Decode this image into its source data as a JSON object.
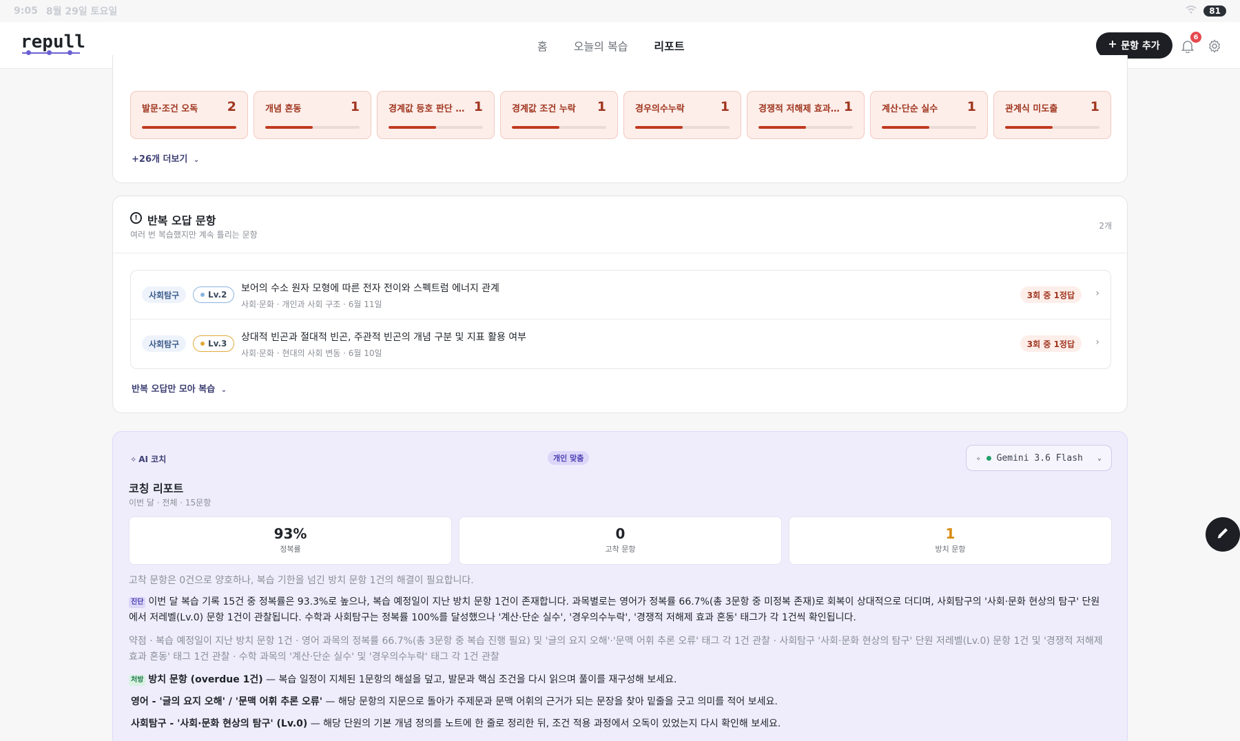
{
  "status_bar": {
    "time": "9:05",
    "date": "8월 29일 토요일",
    "battery": "81"
  },
  "header": {
    "logo": "repull",
    "nav": [
      {
        "label": "홈"
      },
      {
        "label": "오늘의 복습"
      },
      {
        "label": "리포트",
        "active": true
      }
    ],
    "add_button": "문항 추가",
    "notification_count": "6"
  },
  "error_tags": {
    "items": [
      {
        "name": "발문·조건 오독",
        "count": "2",
        "fill": 1.0
      },
      {
        "name": "개념 혼동",
        "count": "1",
        "fill": 0.5
      },
      {
        "name": "경계값 등호 판단 실수",
        "count": "1",
        "fill": 0.5
      },
      {
        "name": "경계값 조건 누락",
        "count": "1",
        "fill": 0.5
      },
      {
        "name": "경우의수누락",
        "count": "1",
        "fill": 0.5
      },
      {
        "name": "경쟁적 저해제 효과 혼동",
        "count": "1",
        "fill": 0.5
      },
      {
        "name": "계산·단순 실수",
        "count": "1",
        "fill": 0.5
      },
      {
        "name": "관계식 미도출",
        "count": "1",
        "fill": 0.5
      }
    ],
    "more_label": "+26개 더보기"
  },
  "repeat_errors": {
    "title": "반복 오답 문항",
    "subtitle": "여러 번 복습했지만 계속 틀리는 문항",
    "count": "2개",
    "items": [
      {
        "subject": "사회탐구",
        "level": "Lv.2",
        "level_color": "#8ab4e0",
        "title": "보어의 수소 원자 모형에 따른 전자 전이와 스펙트럼 에너지 관계",
        "meta": "사회·문화 · 개인과 사회 구조 · 6월 11일",
        "stage": "3회 중 1정답"
      },
      {
        "subject": "사회탐구",
        "level": "Lv.3",
        "level_color": "#e0a93a",
        "title": "상대적 빈곤과 절대적 빈곤, 주관적 빈곤의 개념 구분 및 지표 활용 여부",
        "meta": "사회·문화 · 현대의 사회 변동 · 6월 10일",
        "stage": "3회 중 1정답"
      }
    ],
    "review_label": "반복 오답만 모아 복습"
  },
  "coach": {
    "label": "AI 코치",
    "personalized": "개인 맞춤",
    "model": "Gemini 3.6 Flash",
    "title": "코칭 리포트",
    "subtitle": "이번 달 · 전체 · 15문항",
    "stats": [
      {
        "value": "93%",
        "label": "정복률",
        "color": "#1f2328"
      },
      {
        "value": "0",
        "label": "고착 문항",
        "color": "#1f2328"
      },
      {
        "value": "1",
        "label": "방치 문항",
        "color": "#d98a12"
      }
    ],
    "summary": "고착 문항은 0건으로 양호하나, 복습 기한을 넘긴 방치 문항 1건의 해결이 필요합니다.",
    "diagnosis_tag": "진단",
    "diagnosis": "이번 달 복습 기록 15건 중 정복률은 93.3%로 높으나, 복습 예정일이 지난 방치 문항 1건이 존재합니다. 과목별로는 영어가 정복률 66.7%(총 3문항 중 미정복 존재)로 회복이 상대적으로 더디며, 사회탐구의 '사회·문화 현상의 탐구' 단원에서 저레벨(Lv.0) 문항 1건이 관찰됩니다. 수학과 사회탐구는 정복률 100%를 달성했으나 '계산·단순 실수', '경우의수누락', '경쟁적 저해제 효과 혼동' 태그가 각 1건씩 확인됩니다.",
    "weakness": "약점 · 복습 예정일이 지난 방치 문항 1건 · 영어 과목의 정복률 66.7%(총 3문항 중 복습 진행 필요) 및 '글의 요지 오해'·'문맥 어휘 추론 오류' 태그 각 1건 관찰 · 사회탐구 '사회·문화 현상의 탐구' 단원 저레벨(Lv.0) 문항 1건 및 '경쟁적 저해제 효과 혼동' 태그 1건 관찰 · 수학 과목의 '계산·단순 실수' 및 '경우의수누락' 태그 각 1건 관찰",
    "rx_tag": "처방",
    "prescriptions": [
      {
        "head": "방치 문항 (overdue 1건)",
        "body": " — 복습 일정이 지체된 1문항의 해설을 덮고, 발문과 핵심 조건을 다시 읽으며 풀이를 재구성해 보세요."
      },
      {
        "head": "영어 - '글의 요지 오해' / '문맥 어휘 추론 오류'",
        "body": " — 해당 문항의 지문으로 돌아가 주제문과 문맥 어휘의 근거가 되는 문장을 찾아 밑줄을 긋고 의미를 적어 보세요."
      },
      {
        "head": "사회탐구 - '사회·문화 현상의 탐구' (Lv.0)",
        "body": " — 해당 단원의 기본 개념 정의를 노트에 한 줄로 정리한 뒤, 조건 적용 과정에서 오독이 있었는지 다시 확인해 보세요."
      }
    ]
  }
}
